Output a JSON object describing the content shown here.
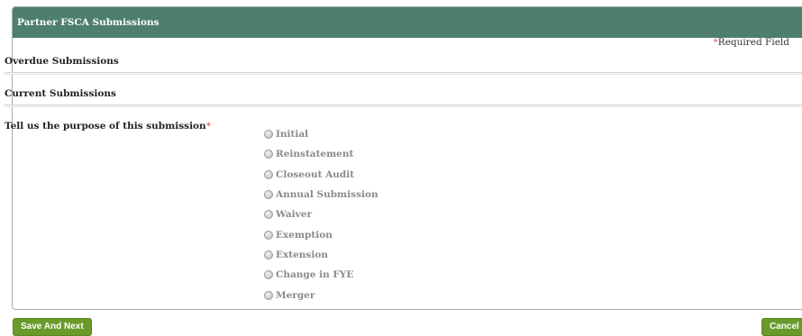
{
  "panel": {
    "title": "Partner FSCA Submissions",
    "required_note_star": "*",
    "required_note": "Required Field"
  },
  "sections": {
    "overdue": "Overdue Submissions",
    "current": "Current Submissions"
  },
  "question": {
    "label": "Tell us the purpose of this submission",
    "required_star": "*"
  },
  "purpose_options": [
    "Initial",
    "Reinstatement",
    "Closeout Audit",
    "Annual Submission",
    "Waiver",
    "Exemption",
    "Extension",
    "Change in FYE",
    "Merger"
  ],
  "buttons": {
    "save_next": "Save And Next",
    "cancel": "Cancel"
  },
  "colors": {
    "header_bg": "#4e7f6d",
    "button_bg": "#6a9a2a",
    "required_star": "#d9534f"
  }
}
